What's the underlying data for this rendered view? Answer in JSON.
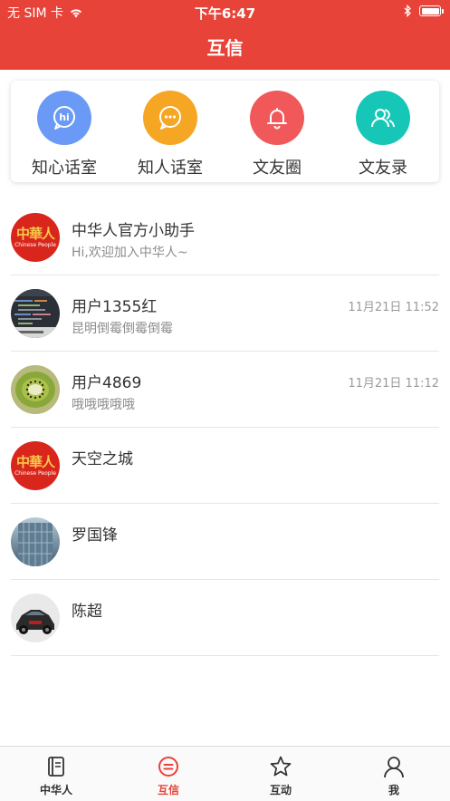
{
  "status_bar": {
    "carrier": "无 SIM 卡",
    "time": "下午6:47"
  },
  "header": {
    "title": "互信"
  },
  "quick_actions": [
    {
      "label": "知心话室",
      "icon": "hi-chat-icon",
      "color": "#6a9af5"
    },
    {
      "label": "知人话室",
      "icon": "chat-bubble-icon",
      "color": "#f5a623"
    },
    {
      "label": "文友圈",
      "icon": "bell-icon",
      "color": "#f0585a"
    },
    {
      "label": "文友录",
      "icon": "contacts-icon",
      "color": "#16c7b8"
    }
  ],
  "chats": [
    {
      "name": "中华人官方小助手",
      "message": "Hi,欢迎加入中华人~",
      "time": "",
      "avatar": "zhonghuaren-logo-avatar",
      "avatar_cn": "中華人",
      "avatar_en": "Chinese People"
    },
    {
      "name": "用户1355红",
      "message": "昆明倒霉倒霉倒霉",
      "time": "11月21日 11:52",
      "avatar": "screen-photo-avatar"
    },
    {
      "name": "用户4869",
      "message": "哦哦哦哦哦",
      "time": "11月21日 11:12",
      "avatar": "kiwi-photo-avatar"
    },
    {
      "name": "天空之城",
      "message": "",
      "time": "",
      "avatar": "zhonghuaren-logo-avatar",
      "avatar_cn": "中華人",
      "avatar_en": "Chinese People"
    },
    {
      "name": "罗国锋",
      "message": "",
      "time": "",
      "avatar": "building-photo-avatar"
    },
    {
      "name": "陈超",
      "message": "",
      "time": "",
      "avatar": "car-photo-avatar"
    }
  ],
  "tabbar": {
    "active_color": "#e84339",
    "tabs": [
      {
        "label": "中华人",
        "icon": "book-icon",
        "active": false
      },
      {
        "label": "互信",
        "icon": "message-icon",
        "active": true
      },
      {
        "label": "互动",
        "icon": "star-icon",
        "active": false
      },
      {
        "label": "我",
        "icon": "person-icon",
        "active": false
      }
    ]
  }
}
